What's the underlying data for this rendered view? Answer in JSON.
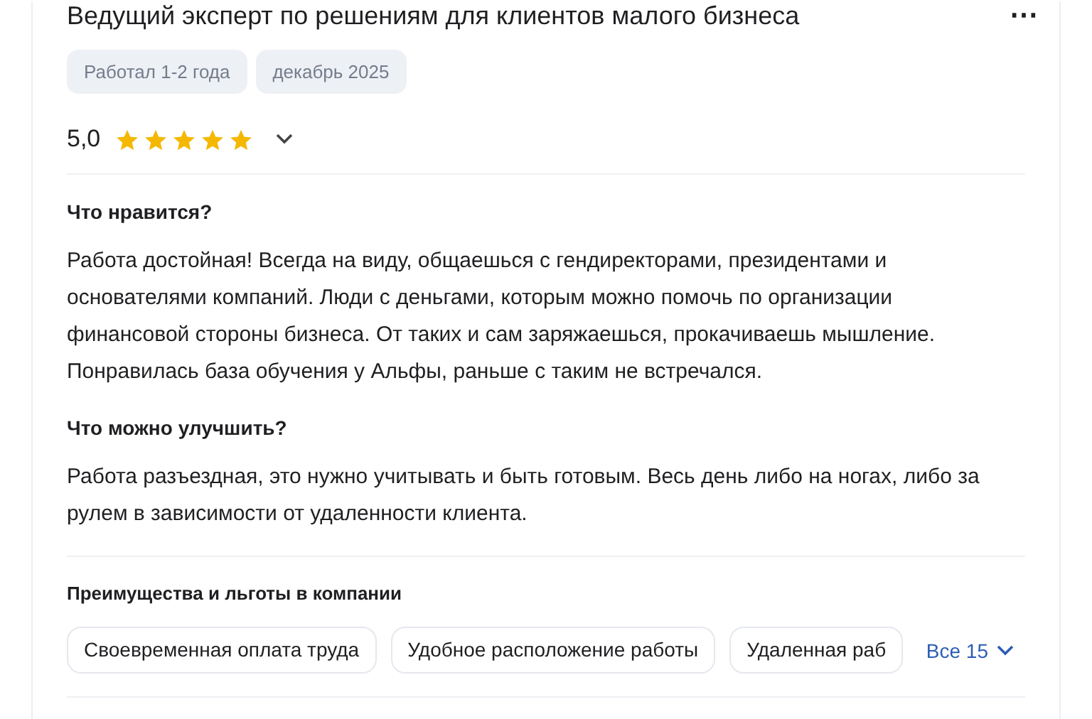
{
  "review": {
    "title": "Ведущий эксперт по решениям для клиентов малого бизнеса",
    "menu_icon": "⋯",
    "tags": [
      "Работал 1-2 года",
      "декабрь 2025"
    ],
    "rating": {
      "value": "5,0",
      "stars": 5,
      "expanded": false
    },
    "sections": [
      {
        "heading": "Что нравится?",
        "text": "Работа достойная! Всегда на виду, общаешься с гендиректорами, президентами и основателями компаний. Люди с деньгами, которым можно помочь по организации финансовой стороны бизнеса. От таких и сам заряжаешься, прокачиваешь мышление. Понравилась база обучения у Альфы, раньше с таким не встречался."
      },
      {
        "heading": "Что можно улучшить?",
        "text": "Работа разъездная, это нужно учитывать и быть готовым. Весь день либо на ногах, либо за рулем в зависимости от удаленности клиента."
      }
    ],
    "benefits": {
      "heading": "Преимущества и льготы в компании",
      "chips": [
        "Своевременная оплата труда",
        "Удобное расположение работы",
        "Удаленная раб"
      ],
      "more": "Все 15",
      "expanded": false
    }
  }
}
